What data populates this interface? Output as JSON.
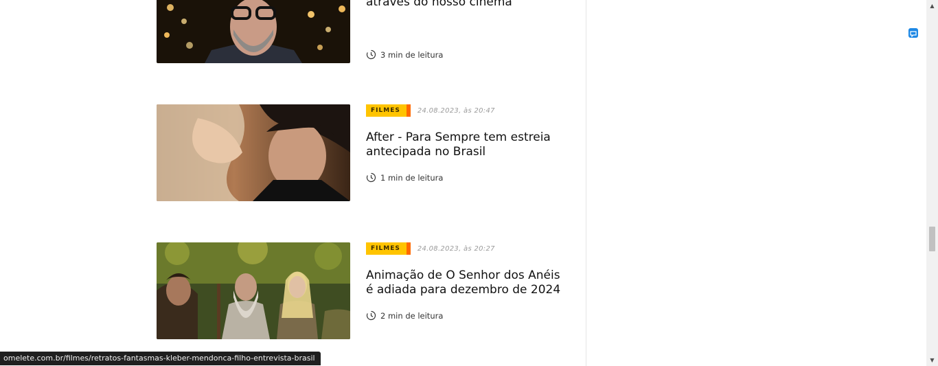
{
  "articles": [
    {
      "title": "Kleber Mendonça: Gringos querem “entender o Brasil” através do nosso cinema",
      "reading_time": "3 min de leitura",
      "image_alt": "Kleber Mendonça Filho"
    },
    {
      "category": "FILMES",
      "date": "24.08.2023, às 20:47",
      "title": "After - Para Sempre tem estreia antecipada no Brasil",
      "reading_time": "1 min de leitura",
      "image_alt": "After - Para Sempre"
    },
    {
      "category": "FILMES",
      "date": "24.08.2023, às 20:27",
      "title": "Animação de O Senhor dos Anéis é adiada para dezembro de 2024",
      "reading_time": "2 min de leitura",
      "image_alt": "O Senhor dos Anéis"
    }
  ],
  "status_bar": {
    "url": "omelete.com.br/filmes/retratos-fantasmas-kleber-mendonca-filho-entrevista-brasil"
  },
  "colors": {
    "badge": "#ffc400",
    "badge_accent": "#ff6a00"
  },
  "icons": {
    "reading": "clock-icon",
    "extension": "chat-extension-icon"
  }
}
